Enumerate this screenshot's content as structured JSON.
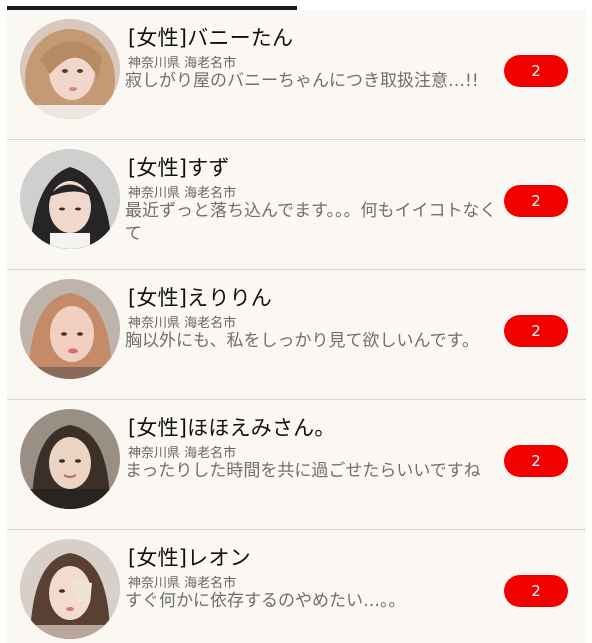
{
  "badge_color": "#f20000",
  "rows": [
    {
      "name": "[女性]バニーたん",
      "location": "神奈川県 海老名市",
      "message": "寂しがり屋のバニーちゃんにつき取扱注意…!!",
      "unread": "2",
      "avatar": "avatar-photo"
    },
    {
      "name": "[女性]すず",
      "location": "神奈川県 海老名市",
      "message": "最近ずっと落ち込んでます。。。何もイイコトなくて",
      "unread": "2",
      "avatar": "avatar-photo"
    },
    {
      "name": "[女性]えりりん",
      "location": "神奈川県 海老名市",
      "message": "胸以外にも、私をしっかり見て欲しいんです。",
      "unread": "2",
      "avatar": "avatar-photo"
    },
    {
      "name": "[女性]ほほえみさん。",
      "location": "神奈川県 海老名市",
      "message": "まったりした時間を共に過ごせたらいいですね",
      "unread": "2",
      "avatar": "avatar-photo"
    },
    {
      "name": "[女性]レオン",
      "location": "神奈川県 海老名市",
      "message": "すぐ何かに依存するのやめたい…。。",
      "unread": "2",
      "avatar": "avatar-photo"
    }
  ]
}
